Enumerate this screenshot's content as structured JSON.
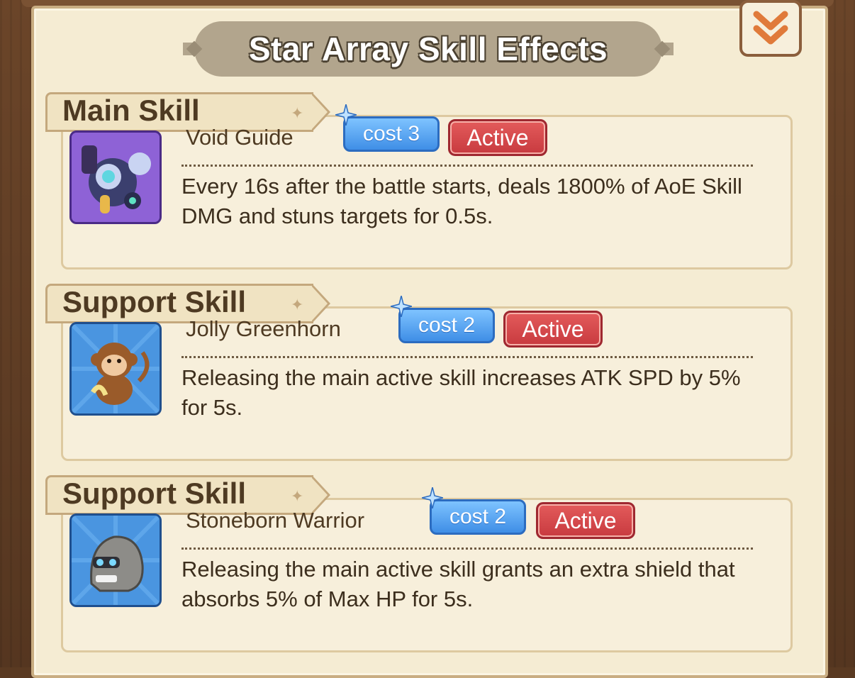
{
  "panel": {
    "title": "Star Array Skill Effects",
    "collapse_icon": "double-chevron-down-icon"
  },
  "sections": [
    {
      "header": "Main Skill",
      "skill_name": "Void Guide",
      "cost": "cost 3",
      "status": "Active",
      "description": "Every 16s after the battle starts, deals 1800% of AoE Skill DMG and stuns targets for 0.5s.",
      "icon": "void-guide-icon"
    },
    {
      "header": "Support Skill",
      "skill_name": "Jolly Greenhorn",
      "cost": "cost 2",
      "status": "Active",
      "description": "Releasing the main active skill increases ATK SPD by 5% for 5s.",
      "icon": "monkey-icon"
    },
    {
      "header": "Support Skill",
      "skill_name": "Stoneborn Warrior",
      "cost": "cost 2",
      "status": "Active",
      "description": "Releasing the main active skill grants an extra shield that absorbs 5% of Max HP for 5s.",
      "icon": "stone-golem-icon"
    }
  ],
  "colors": {
    "panel_bg": "#f5ecd3",
    "cost_blue": "#3f8ee6",
    "active_red": "#c83a3f"
  }
}
